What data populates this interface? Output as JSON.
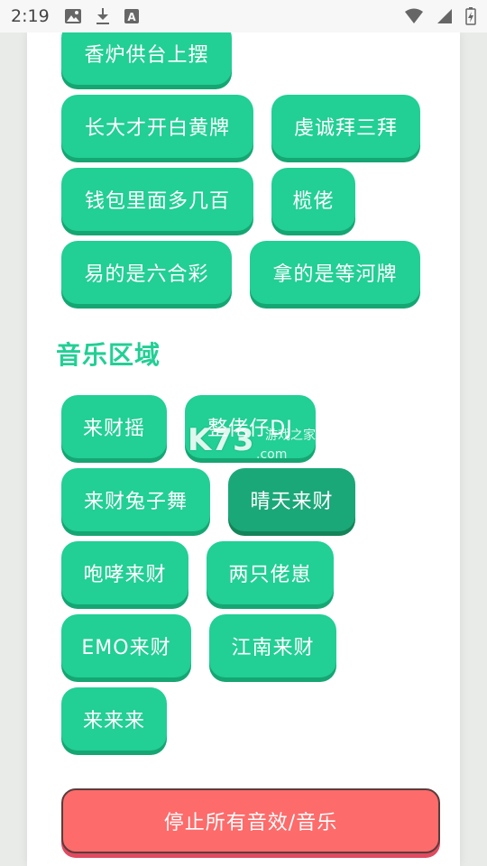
{
  "status_bar": {
    "time": "2:19",
    "icons": [
      "image-icon",
      "download-icon",
      "font-icon",
      "wifi-icon",
      "signal-icon",
      "battery-icon"
    ]
  },
  "sound_buttons": [
    {
      "label": "香炉供台上摆"
    },
    {
      "label": "长大才开白黄牌"
    },
    {
      "label": "虔诚拜三拜"
    },
    {
      "label": "钱包里面多几百"
    },
    {
      "label": "榄佬"
    },
    {
      "label": "易的是六合彩"
    },
    {
      "label": "拿的是等河牌"
    }
  ],
  "music_section": {
    "title": "音乐区域",
    "buttons": [
      {
        "label": "来财摇",
        "active": false
      },
      {
        "label": "整佬仔DJ",
        "active": false
      },
      {
        "label": "来财兔子舞",
        "active": false
      },
      {
        "label": "晴天来财",
        "active": true
      },
      {
        "label": "咆哮来财",
        "active": false
      },
      {
        "label": "两只佬崽",
        "active": false
      },
      {
        "label": "EMO来财",
        "active": false
      },
      {
        "label": "江南来财",
        "active": false
      },
      {
        "label": "来来来",
        "active": false
      }
    ]
  },
  "stop_button": {
    "label": "停止所有音效/音乐"
  },
  "watermark": {
    "brand": "K73",
    "text": "游戏之家",
    "domain": ".com"
  },
  "colors": {
    "accent_green": "#22cf94",
    "active_green": "#1ba878",
    "stop_red": "#fd6b6b"
  }
}
